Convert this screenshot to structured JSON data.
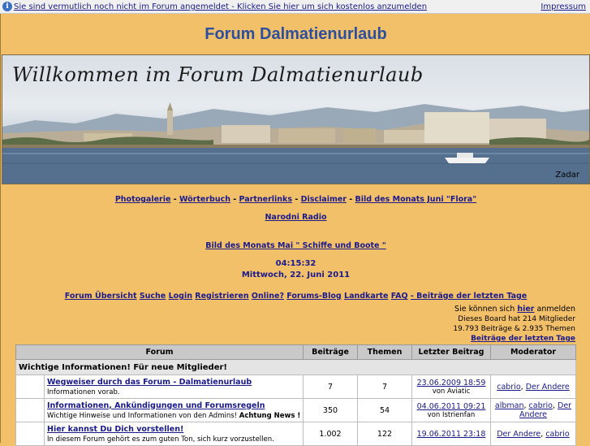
{
  "notice": {
    "text": "Sie sind vermutlich noch nicht im Forum angemeldet - Klicken Sie hier um sich kostenlos anzumelden",
    "impressum": "Impressum",
    "icon": "info-icon"
  },
  "header": {
    "title": "Forum Dalmatienurlaub",
    "banner_title": "Willkommen im Forum Dalmatienurlaub",
    "banner_caption": "Zadar"
  },
  "links": {
    "photogalerie": "Photogalerie",
    "woerterbuch": "Wörterbuch",
    "partnerlinks": "Partnerlinks",
    "disclaimer": "Disclaimer",
    "bild_juni": "Bild des Monats Juni \"Flora\"",
    "narodni_radio": "Narodni Radio",
    "bild_mai": "Bild des Monats Mai \" Schiffe und Boote \""
  },
  "time": {
    "clock": "04:15:32",
    "date": "Mittwoch, 22. Juni 2011"
  },
  "nav": {
    "uebersicht": "Forum Übersicht",
    "suche": "Suche",
    "login": "Login",
    "registrieren": "Registrieren",
    "online": "Online?",
    "blog": "Forums-Blog",
    "landkarte": "Landkarte",
    "faq": "FAQ",
    "letzte": "- Beiträge der letzten Tage"
  },
  "info": {
    "login_prefix": "Sie können sich ",
    "login_link": "hier",
    "login_suffix": " anmelden",
    "board_stats": "Dieses Board hat 214 Mitglieder",
    "post_stats": "19.793 Beiträge & 2.935 Themen",
    "latest_link": "Beiträge der letzten Tage"
  },
  "table": {
    "headers": {
      "forum": "Forum",
      "beitraege": "Beiträge",
      "themen": "Themen",
      "letzter": "Letzter Beitrag",
      "moderator": "Moderator"
    },
    "category": "Wichtige Informationen! Für neue Mitglieder!",
    "rows": [
      {
        "name": "Wegweiser durch das Forum - Dalmatienurlaub",
        "desc": "Informationen vorab.",
        "desc_bold": "",
        "beitraege": "7",
        "themen": "7",
        "last_date": "23.06.2009 18:59",
        "last_by": "von Aviatic",
        "mod1": "cabrio",
        "mod2": "Der Andere"
      },
      {
        "name": "Informationen, Ankündigungen und Forumsregeln",
        "desc": "Wichtige Hinweise und Informationen von den Admins! ",
        "desc_bold": "Achtung News !",
        "beitraege": "350",
        "themen": "54",
        "last_date": "04.06.2011 09:21",
        "last_by": "von Istrienfan",
        "mod1": "albman",
        "mod2": "cabrio",
        "mod3": "Der Andere"
      },
      {
        "name": "Hier kannst Du Dich vorstellen!",
        "desc": "In diesem Forum gehört es zum guten Ton, sich kurz vorzustellen.",
        "desc_bold": "",
        "beitraege": "1.002",
        "themen": "122",
        "last_date": "19.06.2011 23:18",
        "last_by": "",
        "mod1": "Der Andere",
        "mod2": "cabrio"
      }
    ]
  },
  "colors": {
    "background": "#f3c06a",
    "link": "#1a1a8c",
    "title": "#2c4f9e"
  }
}
